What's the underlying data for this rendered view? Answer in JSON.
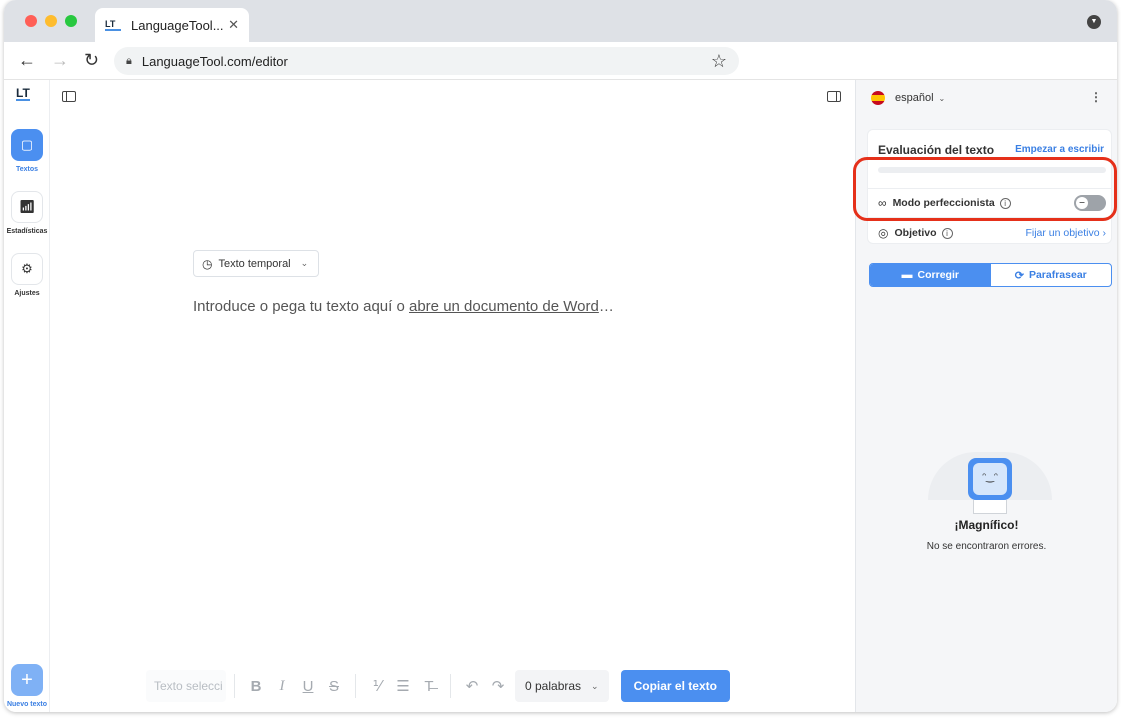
{
  "browser": {
    "tab_title": "LanguageTool...",
    "tab_logo": "LT",
    "url": "LanguageTool.com/editor"
  },
  "rail": {
    "logo": "LT",
    "items": [
      {
        "label": "Textos",
        "icon": "document-icon",
        "active": true
      },
      {
        "label": "Estadísticas",
        "icon": "stats-icon",
        "active": false
      },
      {
        "label": "Ajustes",
        "icon": "gear-icon",
        "active": false
      }
    ],
    "new_label": "Nuevo texto"
  },
  "editor": {
    "temp_select": "Texto temporal",
    "placeholder_prefix": "Introduce o pega tu texto aquí o ",
    "placeholder_link": "abre un documento de Word",
    "placeholder_suffix": "…",
    "toolbar": {
      "selection_placeholder": "Texto selecci",
      "words": "0 palabras",
      "copy": "Copiar el texto"
    }
  },
  "sidebar": {
    "language": "español",
    "evaluation_title": "Evaluación del texto",
    "evaluation_link": "Empezar a escribir",
    "evaluation_progress": 0,
    "perfectionist_label": "Modo perfeccionista",
    "perfectionist_on": false,
    "objective_label": "Objetivo",
    "objective_link": "Fijar un objetivo",
    "modes": [
      "Corregir",
      "Parafrasear"
    ],
    "active_mode": "Corregir",
    "empty_title": "¡Magnífico!",
    "empty_subtitle": "No se encontraron errores."
  },
  "colors": {
    "accent": "#4b8ff0",
    "highlight": "#e5301a"
  }
}
